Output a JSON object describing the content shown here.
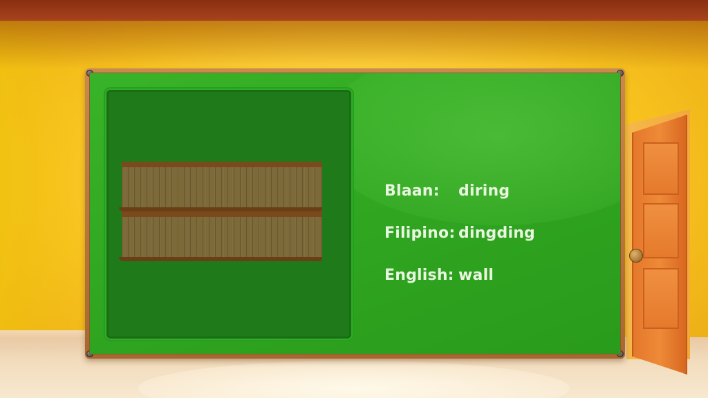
{
  "vocabulary": [
    {
      "label": "Blaan:",
      "value": "diring"
    },
    {
      "label": "Filipino:",
      "value": "dingding"
    },
    {
      "label": "English:",
      "value": "wall"
    }
  ],
  "picture": {
    "icon": "wall-planks-icon"
  },
  "colors": {
    "board_green": "#2fa520",
    "panel_green": "#1f7a1a",
    "frame_brown": "#a8672f",
    "text_color": "#e8f6df",
    "wall_yellow": "#ffd23a",
    "door_orange": "#ee8a38"
  }
}
